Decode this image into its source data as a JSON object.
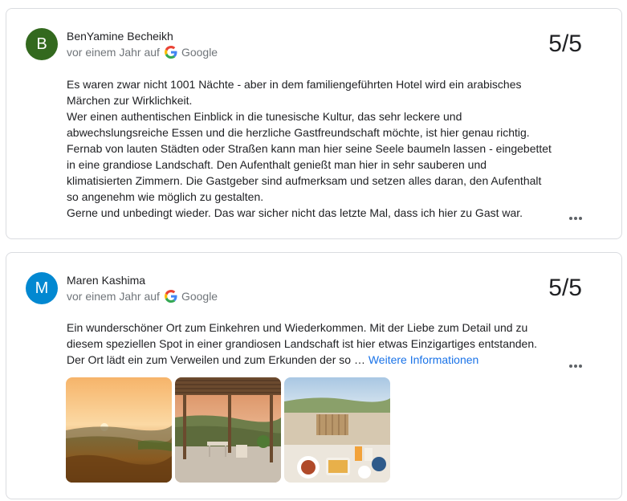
{
  "reviews": [
    {
      "avatar_letter": "B",
      "avatar_color": "#33691e",
      "name": "BenYamine Becheikh",
      "time": "vor einem Jahr auf",
      "source": "Google",
      "rating": "5/5",
      "text_lines": [
        "Es waren zwar nicht 1001 Nächte - aber in dem familiengeführten Hotel wird ein arabisches",
        "Märchen zur Wirklichkeit.",
        "Wer einen authentischen Einblick in die tunesische Kultur, das sehr leckere und",
        "abwechslungsreiche Essen und die herzliche Gastfreundschaft möchte, ist hier genau richtig.",
        "Fernab von lauten Städten oder Straßen kann man hier seine Seele baumeln lassen - eingebettet",
        "in eine grandiose Landschaft. Den Aufenthalt genießt man hier in sehr sauberen und",
        "klimatisierten Zimmern. Die Gastgeber sind aufmerksam und setzen alles daran, den Aufenthalt",
        "so angenehm wie möglich zu gestalten.",
        "Gerne und unbedingt wieder. Das war sicher nicht das letzte Mal, dass ich hier zu Gast war."
      ]
    },
    {
      "avatar_letter": "M",
      "avatar_color": "#0288d1",
      "name": "Maren Kashima",
      "time": "vor einem Jahr auf",
      "source": "Google",
      "rating": "5/5",
      "text_lines": [
        "Ein wunderschöner Ort zum Einkehren und Wiederkommen. Mit der Liebe zum Detail und zu",
        "diesem speziellen Spot in einer grandiosen Landschaft ist hier etwas Einzigartiges entstanden.",
        "Der Ort lädt ein zum Verweilen und zum Erkunden der so … "
      ],
      "more_label": "Weitere Informationen",
      "photos": [
        "sunset-landscape-photo",
        "pergola-terrace-photo",
        "breakfast-table-photo"
      ]
    }
  ]
}
